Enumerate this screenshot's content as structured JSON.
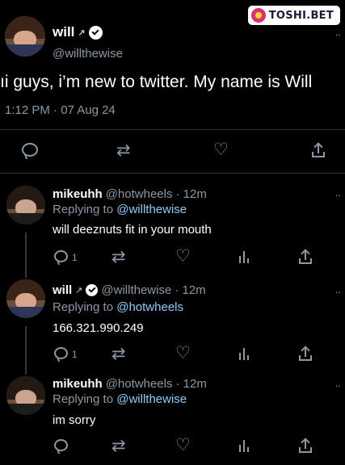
{
  "badge": {
    "text": "TOSHI.BET"
  },
  "main_tweet": {
    "name": "will",
    "handle": "@willthewise",
    "text": "ıi guys, i’m new to twitter. My name is Will",
    "timestamp": "1:12 PM · 07 Aug 24",
    "more": "··"
  },
  "replies": [
    {
      "name": "mikeuhh",
      "handle": "@hotwheels",
      "time": "· 12m",
      "replying_prefix": "Replying to ",
      "replying_to": "@willthewise",
      "text": "will deeznuts fit in your mouth",
      "reply_count": "1",
      "more": "··"
    },
    {
      "name": "will",
      "handle": "@willthewise",
      "time": "· 12m",
      "replying_prefix": "Replying to ",
      "replying_to": "@hotwheels",
      "text": "166.321.990.249",
      "reply_count": "1",
      "more": "··"
    },
    {
      "name": "mikeuhh",
      "handle": "@hotwheels",
      "time": "· 12m",
      "replying_prefix": "Replying to ",
      "replying_to": "@willthewise",
      "text": "im sorry",
      "more": "··"
    }
  ],
  "colors": {
    "background": "#000000",
    "mention": "#8ecdf8",
    "muted": "#8b98a5",
    "divider": "#2f3336"
  },
  "icons": [
    "reply-icon",
    "retweet-icon",
    "like-icon",
    "views-icon",
    "share-icon",
    "verified-icon",
    "wand-icon",
    "more-icon"
  ]
}
